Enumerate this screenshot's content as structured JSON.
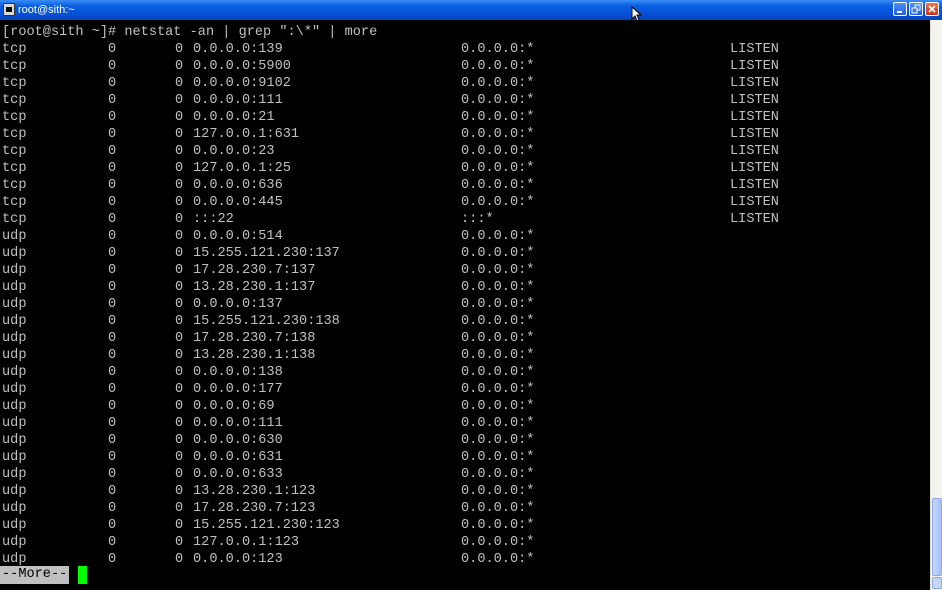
{
  "window": {
    "title": "root@sith:~",
    "minimize_icon": "minimize-icon",
    "maximize_icon": "restore-icon",
    "close_icon": "close-icon"
  },
  "terminal": {
    "command_line": "[root@sith ~]# netstat -an | grep \":\\*\" | more",
    "rows": [
      {
        "proto": "tcp",
        "recv": "0",
        "send": "0",
        "local": "0.0.0.0:139",
        "foreign": "0.0.0.0:*",
        "state": "LISTEN"
      },
      {
        "proto": "tcp",
        "recv": "0",
        "send": "0",
        "local": "0.0.0.0:5900",
        "foreign": "0.0.0.0:*",
        "state": "LISTEN"
      },
      {
        "proto": "tcp",
        "recv": "0",
        "send": "0",
        "local": "0.0.0.0:9102",
        "foreign": "0.0.0.0:*",
        "state": "LISTEN"
      },
      {
        "proto": "tcp",
        "recv": "0",
        "send": "0",
        "local": "0.0.0.0:111",
        "foreign": "0.0.0.0:*",
        "state": "LISTEN"
      },
      {
        "proto": "tcp",
        "recv": "0",
        "send": "0",
        "local": "0.0.0.0:21",
        "foreign": "0.0.0.0:*",
        "state": "LISTEN"
      },
      {
        "proto": "tcp",
        "recv": "0",
        "send": "0",
        "local": "127.0.0.1:631",
        "foreign": "0.0.0.0:*",
        "state": "LISTEN"
      },
      {
        "proto": "tcp",
        "recv": "0",
        "send": "0",
        "local": "0.0.0.0:23",
        "foreign": "0.0.0.0:*",
        "state": "LISTEN"
      },
      {
        "proto": "tcp",
        "recv": "0",
        "send": "0",
        "local": "127.0.0.1:25",
        "foreign": "0.0.0.0:*",
        "state": "LISTEN"
      },
      {
        "proto": "tcp",
        "recv": "0",
        "send": "0",
        "local": "0.0.0.0:636",
        "foreign": "0.0.0.0:*",
        "state": "LISTEN"
      },
      {
        "proto": "tcp",
        "recv": "0",
        "send": "0",
        "local": "0.0.0.0:445",
        "foreign": "0.0.0.0:*",
        "state": "LISTEN"
      },
      {
        "proto": "tcp",
        "recv": "0",
        "send": "0",
        "local": ":::22",
        "foreign": ":::*",
        "state": "LISTEN"
      },
      {
        "proto": "udp",
        "recv": "0",
        "send": "0",
        "local": "0.0.0.0:514",
        "foreign": "0.0.0.0:*",
        "state": ""
      },
      {
        "proto": "udp",
        "recv": "0",
        "send": "0",
        "local": "15.255.121.230:137",
        "foreign": "0.0.0.0:*",
        "state": ""
      },
      {
        "proto": "udp",
        "recv": "0",
        "send": "0",
        "local": "17.28.230.7:137",
        "foreign": "0.0.0.0:*",
        "state": ""
      },
      {
        "proto": "udp",
        "recv": "0",
        "send": "0",
        "local": "13.28.230.1:137",
        "foreign": "0.0.0.0:*",
        "state": ""
      },
      {
        "proto": "udp",
        "recv": "0",
        "send": "0",
        "local": "0.0.0.0:137",
        "foreign": "0.0.0.0:*",
        "state": ""
      },
      {
        "proto": "udp",
        "recv": "0",
        "send": "0",
        "local": "15.255.121.230:138",
        "foreign": "0.0.0.0:*",
        "state": ""
      },
      {
        "proto": "udp",
        "recv": "0",
        "send": "0",
        "local": "17.28.230.7:138",
        "foreign": "0.0.0.0:*",
        "state": ""
      },
      {
        "proto": "udp",
        "recv": "0",
        "send": "0",
        "local": "13.28.230.1:138",
        "foreign": "0.0.0.0:*",
        "state": ""
      },
      {
        "proto": "udp",
        "recv": "0",
        "send": "0",
        "local": "0.0.0.0:138",
        "foreign": "0.0.0.0:*",
        "state": ""
      },
      {
        "proto": "udp",
        "recv": "0",
        "send": "0",
        "local": "0.0.0.0:177",
        "foreign": "0.0.0.0:*",
        "state": ""
      },
      {
        "proto": "udp",
        "recv": "0",
        "send": "0",
        "local": "0.0.0.0:69",
        "foreign": "0.0.0.0:*",
        "state": ""
      },
      {
        "proto": "udp",
        "recv": "0",
        "send": "0",
        "local": "0.0.0.0:111",
        "foreign": "0.0.0.0:*",
        "state": ""
      },
      {
        "proto": "udp",
        "recv": "0",
        "send": "0",
        "local": "0.0.0.0:630",
        "foreign": "0.0.0.0:*",
        "state": ""
      },
      {
        "proto": "udp",
        "recv": "0",
        "send": "0",
        "local": "0.0.0.0:631",
        "foreign": "0.0.0.0:*",
        "state": ""
      },
      {
        "proto": "udp",
        "recv": "0",
        "send": "0",
        "local": "0.0.0.0:633",
        "foreign": "0.0.0.0:*",
        "state": ""
      },
      {
        "proto": "udp",
        "recv": "0",
        "send": "0",
        "local": "13.28.230.1:123",
        "foreign": "0.0.0.0:*",
        "state": ""
      },
      {
        "proto": "udp",
        "recv": "0",
        "send": "0",
        "local": "17.28.230.7:123",
        "foreign": "0.0.0.0:*",
        "state": ""
      },
      {
        "proto": "udp",
        "recv": "0",
        "send": "0",
        "local": "15.255.121.230:123",
        "foreign": "0.0.0.0:*",
        "state": ""
      },
      {
        "proto": "udp",
        "recv": "0",
        "send": "0",
        "local": "127.0.0.1:123",
        "foreign": "0.0.0.0:*",
        "state": ""
      },
      {
        "proto": "udp",
        "recv": "0",
        "send": "0",
        "local": "0.0.0.0:123",
        "foreign": "0.0.0.0:*",
        "state": ""
      }
    ],
    "more_prompt": "--More--",
    "colors": {
      "background": "#000000",
      "foreground": "#c0c0c0",
      "cursor": "#00ff00",
      "titlebar": "#0551d8"
    }
  }
}
